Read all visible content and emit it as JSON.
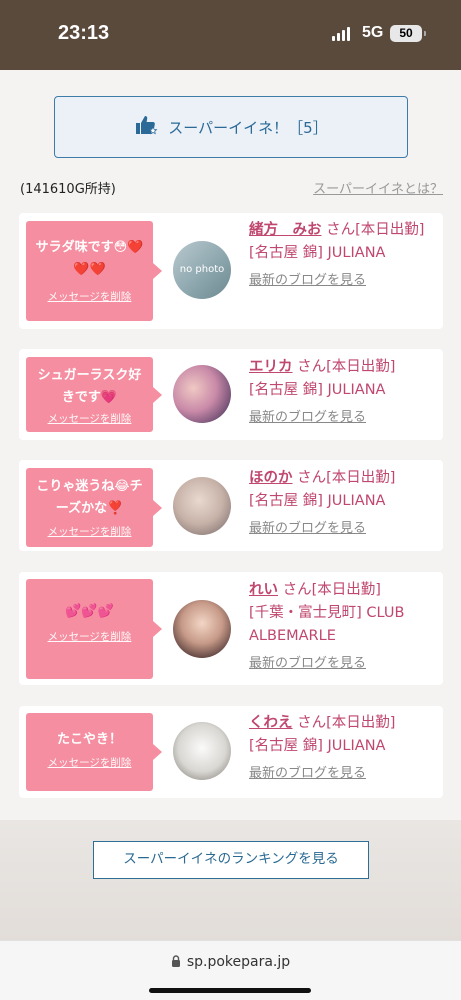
{
  "status_bar": {
    "time": "23:13",
    "network": "5G",
    "battery": "50"
  },
  "super_like": {
    "label": "スーパーイイネ！［5］",
    "icon": "thumbs-up-star-icon"
  },
  "balance_text": "(141610G所持)",
  "about_link": "スーパーイイネとは？",
  "delete_label": "メッセージを削除",
  "blog_label": "最新のブログを見る",
  "cards": [
    {
      "message": "サラダ味です😳❤️❤️❤️",
      "name": "緒方　みお",
      "suffix": "さん[本日出勤]",
      "shop": "[名古屋 錦] JULIANA",
      "avatar_text": "no photo"
    },
    {
      "message": "シュガーラスク好きです💗",
      "name": "エリカ",
      "suffix": "さん[本日出勤]",
      "shop": "[名古屋 錦] JULIANA"
    },
    {
      "message": "こりゃ迷うね😂チーズかな❣️",
      "name": "ほのか",
      "suffix": "さん[本日出勤]",
      "shop": "[名古屋 錦] JULIANA"
    },
    {
      "message": "💕💕💕",
      "name": "れい",
      "suffix": "さん[本日出勤]",
      "shop": "[千葉・富士見町] CLUB ALBEMARLE"
    },
    {
      "message": "たこやき！",
      "name": "くわえ",
      "suffix": "さん[本日出勤]",
      "shop": "[名古屋 錦] JULIANA"
    }
  ],
  "ranking_button": "スーパーイイネのランキングを見る",
  "browser": {
    "url": "sp.pokepara.jp"
  },
  "colors": {
    "accent_blue": "#2b6a98",
    "message_pink": "#f58ea0",
    "name_pink": "#c0476e"
  }
}
